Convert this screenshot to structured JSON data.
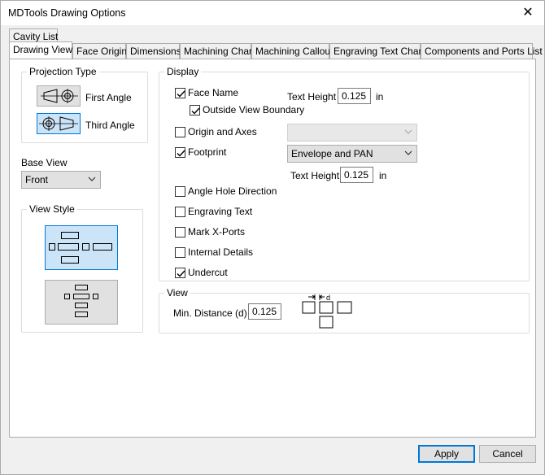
{
  "window": {
    "title": "MDTools Drawing Options",
    "close_glyph": "✕"
  },
  "tabs": {
    "row1": [
      "Cavity List"
    ],
    "row2": [
      "Drawing View",
      "Face Origin",
      "Dimensions",
      "Machining Chart",
      "Machining Callout",
      "Engraving Text Chart",
      "Components and Ports List"
    ],
    "selected": "Drawing View"
  },
  "projection": {
    "title": "Projection Type",
    "first_angle": "First Angle",
    "third_angle": "Third Angle",
    "selected": "Third Angle"
  },
  "base_view": {
    "label": "Base View",
    "value": "Front"
  },
  "view_style": {
    "title": "View Style",
    "selected": "cross"
  },
  "display": {
    "title": "Display",
    "face_name": {
      "label": "Face Name",
      "checked": true
    },
    "text_height_label": "Text Height",
    "face_text_height": "0.125",
    "unit": "in",
    "outside_view_boundary": {
      "label": "Outside View Boundary",
      "checked": true
    },
    "origin_and_axes": {
      "label": "Origin and Axes",
      "checked": false,
      "combo_value": ""
    },
    "footprint": {
      "label": "Footprint",
      "checked": true,
      "combo_value": "Envelope and PAN"
    },
    "footprint_text_height": "0.125",
    "angle_hole_direction": {
      "label": "Angle Hole Direction",
      "checked": false
    },
    "engraving_text": {
      "label": "Engraving Text",
      "checked": false
    },
    "mark_x_ports": {
      "label": "Mark X-Ports",
      "checked": false
    },
    "internal_details": {
      "label": "Internal Details",
      "checked": false
    },
    "undercut": {
      "label": "Undercut",
      "checked": true
    }
  },
  "view": {
    "title": "View",
    "min_distance_label": "Min. Distance (d)",
    "min_distance_value": "0.125",
    "diagram_label": "d"
  },
  "buttons": {
    "apply": "Apply",
    "cancel": "Cancel"
  }
}
